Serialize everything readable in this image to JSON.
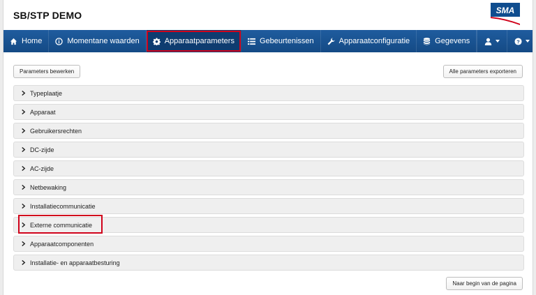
{
  "header": {
    "title": "SB/STP DEMO",
    "logo_text": "SMA"
  },
  "nav": {
    "items": [
      {
        "label": "Home",
        "icon": "home-icon"
      },
      {
        "label": "Momentane waarden",
        "icon": "info-icon"
      },
      {
        "label": "Apparaatparameters",
        "icon": "gear-icon",
        "active": true
      },
      {
        "label": "Gebeurtenissen",
        "icon": "list-icon"
      },
      {
        "label": "Apparaatconfiguratie",
        "icon": "wrench-icon"
      },
      {
        "label": "Gegevens",
        "icon": "database-icon"
      }
    ],
    "right": [
      {
        "icon": "user-icon"
      },
      {
        "icon": "help-icon"
      }
    ]
  },
  "toolbar": {
    "edit_label": "Parameters bewerken",
    "export_label": "Alle parameters exporteren"
  },
  "panels": [
    "Typeplaatje",
    "Apparaat",
    "Gebruikersrechten",
    "DC-zijde",
    "AC-zijde",
    "Netbewaking",
    "Installatiecommunicatie",
    "Externe communicatie",
    "Apparaatcomponenten",
    "Installatie- en apparaatbesturing"
  ],
  "footer": {
    "top_label": "Naar begin van de pagina"
  },
  "colors": {
    "navbar": "#1a5695",
    "highlight": "#d0021b",
    "brand": "#0f4d8f"
  }
}
